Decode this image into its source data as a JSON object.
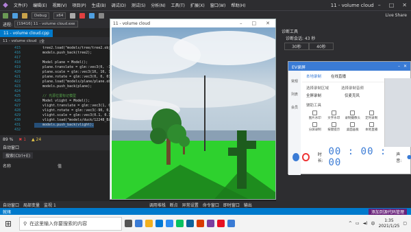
{
  "menubar": {
    "items": [
      "文件(F)",
      "编辑(E)",
      "视图(V)",
      "项目(P)",
      "生成(B)",
      "调试(D)",
      "测试(S)",
      "分析(N)",
      "工具(T)",
      "扩展(X)",
      "窗口(W)",
      "帮助(H)"
    ],
    "search_placeholder": "搜索 (Ctrl+Q)",
    "window_title": "11 - volume cloud"
  },
  "toolbar": {
    "config": "Debug",
    "platform": "x64",
    "live_share": "Live Share"
  },
  "procbar": {
    "label": "进程:",
    "process": "[19416] 11 - volume cloud.exe"
  },
  "tab": {
    "active": "11 - volume cloud.cpp"
  },
  "navbar": {
    "scope": "11 - volume cloud",
    "global": "(全"
  },
  "editor": {
    "line_numbers": [
      "415",
      "416",
      "417",
      "418",
      "419",
      "420",
      "421",
      "422",
      "423",
      "424",
      "425",
      "426",
      "427",
      "428",
      "429",
      "430",
      "431",
      "432"
    ],
    "lines": [
      "    tree2.load(\"models/tree/tree2.obj\");",
      "    models.push_back(tree2);",
      "",
      "    Model plane = Model();",
      "    plane.translate = glm::vec3(0, -1.1, 0);",
      "    plane.scale = glm::vec3(10, 10, 10);",
      "    plane.rotate = glm::vec3(0, 0, 0);",
      "    plane.load(\"models/plane/plane.obj\");",
      "    models.push_back(plane);",
      "",
      "    // 光源位置标记模型",
      "    Model vlight = Model();",
      "    vlight.translate = glm::vec3(1, 0, -1);",
      "    vlight.rotate = glm::vec3(-90, 0, 0);",
      "    vlight.scale = glm::vec3(0.1, 0.1, 0.1);",
      "    vlight.load(\"models/duck/12248_Bird_v1_L2.obj\");",
      "    models.push_back(vlight);",
      ""
    ]
  },
  "editor_status": {
    "zoom": "89 %",
    "errors": "1",
    "warnings": "24"
  },
  "bottom_panel": {
    "title": "自动窗口",
    "search_placeholder": "搜索(Ctrl+E)",
    "col_name": "名称",
    "col_value": "值",
    "tabs": [
      "自动窗口",
      "局部变量",
      "监视 1"
    ]
  },
  "cube_window": {
    "title": "11 - volume cloud"
  },
  "right_panel": {
    "head": "诊断工具",
    "line1": "诊断会话: 43 秒",
    "cols": [
      "30秒",
      "40秒"
    ]
  },
  "ev": {
    "title": "EV录屏",
    "sidebar": [
      "常规",
      "列表",
      "会员"
    ],
    "tabs": [
      "本地录制",
      "在线直播"
    ],
    "area_label": "选择录制区域",
    "audio_label": "选择录制音频",
    "area_value": "全屏录制",
    "audio_value": "仅麦克风",
    "tools_label": "辅助工具",
    "tools": [
      "图片水印",
      "文字水印",
      "录制摄像头",
      "定时录制",
      "分屏录制",
      "按键提示",
      "桌面画板",
      "本地直播"
    ],
    "time_label": "时长:",
    "time_value": "00 : 00 : 00",
    "volume_label": "声音:"
  },
  "out_tabs": [
    "调用堆栈",
    "断点",
    "异常设置",
    "命令窗口",
    "即时窗口",
    "输出"
  ],
  "statusbar": {
    "left": "就绪",
    "right": "添加到源代码管理"
  },
  "taskbar": {
    "search_text": "在这里输入你要搜索的内容",
    "time": "1:35",
    "date": "2021/1/25",
    "lang": "中"
  },
  "colors": {
    "vs_bg": "#1e1e1e",
    "vs_blue": "#007acc",
    "ev_blue": "#3a7bd5",
    "grass": "#2ed12e"
  }
}
